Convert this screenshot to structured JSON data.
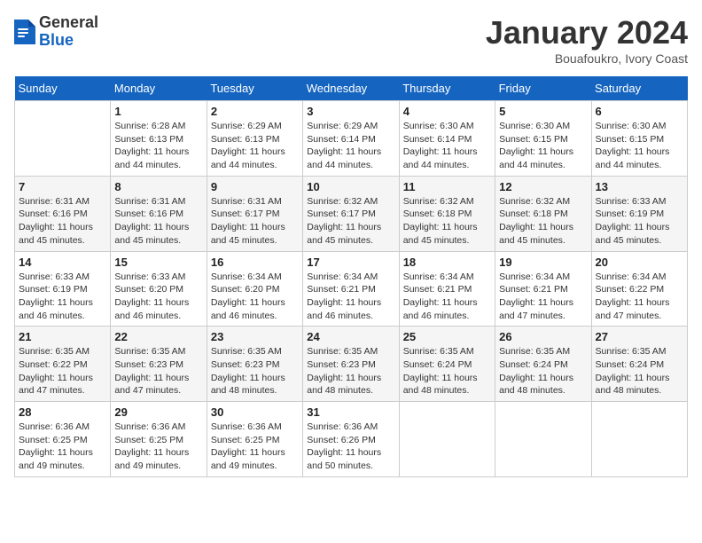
{
  "header": {
    "logo_general": "General",
    "logo_blue": "Blue",
    "month_title": "January 2024",
    "subtitle": "Bouafoukro, Ivory Coast"
  },
  "days_of_week": [
    "Sunday",
    "Monday",
    "Tuesday",
    "Wednesday",
    "Thursday",
    "Friday",
    "Saturday"
  ],
  "weeks": [
    [
      {
        "day": "",
        "info": ""
      },
      {
        "day": "1",
        "info": "Sunrise: 6:28 AM\nSunset: 6:13 PM\nDaylight: 11 hours and 44 minutes."
      },
      {
        "day": "2",
        "info": "Sunrise: 6:29 AM\nSunset: 6:13 PM\nDaylight: 11 hours and 44 minutes."
      },
      {
        "day": "3",
        "info": "Sunrise: 6:29 AM\nSunset: 6:14 PM\nDaylight: 11 hours and 44 minutes."
      },
      {
        "day": "4",
        "info": "Sunrise: 6:30 AM\nSunset: 6:14 PM\nDaylight: 11 hours and 44 minutes."
      },
      {
        "day": "5",
        "info": "Sunrise: 6:30 AM\nSunset: 6:15 PM\nDaylight: 11 hours and 44 minutes."
      },
      {
        "day": "6",
        "info": "Sunrise: 6:30 AM\nSunset: 6:15 PM\nDaylight: 11 hours and 44 minutes."
      }
    ],
    [
      {
        "day": "7",
        "info": "Sunrise: 6:31 AM\nSunset: 6:16 PM\nDaylight: 11 hours and 45 minutes."
      },
      {
        "day": "8",
        "info": "Sunrise: 6:31 AM\nSunset: 6:16 PM\nDaylight: 11 hours and 45 minutes."
      },
      {
        "day": "9",
        "info": "Sunrise: 6:31 AM\nSunset: 6:17 PM\nDaylight: 11 hours and 45 minutes."
      },
      {
        "day": "10",
        "info": "Sunrise: 6:32 AM\nSunset: 6:17 PM\nDaylight: 11 hours and 45 minutes."
      },
      {
        "day": "11",
        "info": "Sunrise: 6:32 AM\nSunset: 6:18 PM\nDaylight: 11 hours and 45 minutes."
      },
      {
        "day": "12",
        "info": "Sunrise: 6:32 AM\nSunset: 6:18 PM\nDaylight: 11 hours and 45 minutes."
      },
      {
        "day": "13",
        "info": "Sunrise: 6:33 AM\nSunset: 6:19 PM\nDaylight: 11 hours and 45 minutes."
      }
    ],
    [
      {
        "day": "14",
        "info": "Sunrise: 6:33 AM\nSunset: 6:19 PM\nDaylight: 11 hours and 46 minutes."
      },
      {
        "day": "15",
        "info": "Sunrise: 6:33 AM\nSunset: 6:20 PM\nDaylight: 11 hours and 46 minutes."
      },
      {
        "day": "16",
        "info": "Sunrise: 6:34 AM\nSunset: 6:20 PM\nDaylight: 11 hours and 46 minutes."
      },
      {
        "day": "17",
        "info": "Sunrise: 6:34 AM\nSunset: 6:21 PM\nDaylight: 11 hours and 46 minutes."
      },
      {
        "day": "18",
        "info": "Sunrise: 6:34 AM\nSunset: 6:21 PM\nDaylight: 11 hours and 46 minutes."
      },
      {
        "day": "19",
        "info": "Sunrise: 6:34 AM\nSunset: 6:21 PM\nDaylight: 11 hours and 47 minutes."
      },
      {
        "day": "20",
        "info": "Sunrise: 6:34 AM\nSunset: 6:22 PM\nDaylight: 11 hours and 47 minutes."
      }
    ],
    [
      {
        "day": "21",
        "info": "Sunrise: 6:35 AM\nSunset: 6:22 PM\nDaylight: 11 hours and 47 minutes."
      },
      {
        "day": "22",
        "info": "Sunrise: 6:35 AM\nSunset: 6:23 PM\nDaylight: 11 hours and 47 minutes."
      },
      {
        "day": "23",
        "info": "Sunrise: 6:35 AM\nSunset: 6:23 PM\nDaylight: 11 hours and 48 minutes."
      },
      {
        "day": "24",
        "info": "Sunrise: 6:35 AM\nSunset: 6:23 PM\nDaylight: 11 hours and 48 minutes."
      },
      {
        "day": "25",
        "info": "Sunrise: 6:35 AM\nSunset: 6:24 PM\nDaylight: 11 hours and 48 minutes."
      },
      {
        "day": "26",
        "info": "Sunrise: 6:35 AM\nSunset: 6:24 PM\nDaylight: 11 hours and 48 minutes."
      },
      {
        "day": "27",
        "info": "Sunrise: 6:35 AM\nSunset: 6:24 PM\nDaylight: 11 hours and 48 minutes."
      }
    ],
    [
      {
        "day": "28",
        "info": "Sunrise: 6:36 AM\nSunset: 6:25 PM\nDaylight: 11 hours and 49 minutes."
      },
      {
        "day": "29",
        "info": "Sunrise: 6:36 AM\nSunset: 6:25 PM\nDaylight: 11 hours and 49 minutes."
      },
      {
        "day": "30",
        "info": "Sunrise: 6:36 AM\nSunset: 6:25 PM\nDaylight: 11 hours and 49 minutes."
      },
      {
        "day": "31",
        "info": "Sunrise: 6:36 AM\nSunset: 6:26 PM\nDaylight: 11 hours and 50 minutes."
      },
      {
        "day": "",
        "info": ""
      },
      {
        "day": "",
        "info": ""
      },
      {
        "day": "",
        "info": ""
      }
    ]
  ]
}
